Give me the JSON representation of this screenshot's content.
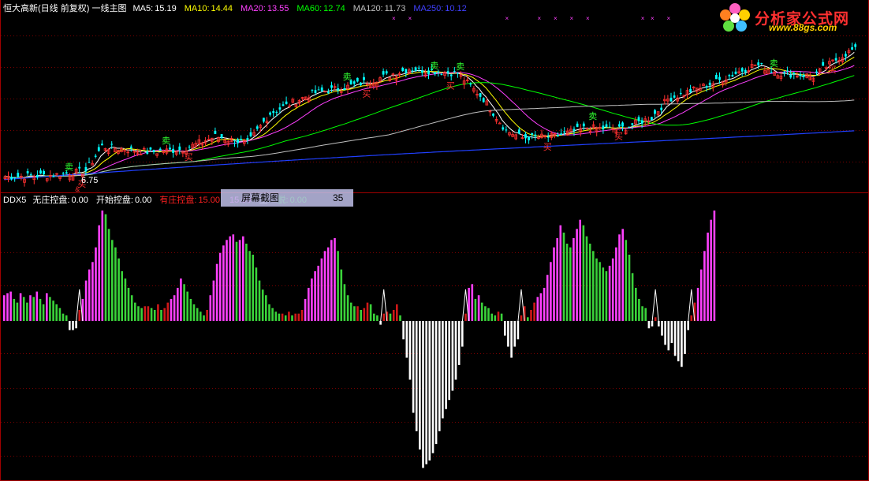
{
  "main_header": {
    "stock": "恒大高新(日线 前复权) 一线主图",
    "items": [
      {
        "label": "MA5:",
        "value": "15.19",
        "color": "#ffffff"
      },
      {
        "label": "MA10:",
        "value": "14.44",
        "color": "#ffff00"
      },
      {
        "label": "MA20:",
        "value": "13.55",
        "color": "#ff40ff"
      },
      {
        "label": "MA60:",
        "value": "12.74",
        "color": "#00ff00"
      },
      {
        "label": "MA120:",
        "value": "11.73",
        "color": "#c0c0c0"
      },
      {
        "label": "MA250:",
        "value": "10.12",
        "color": "#4040ff"
      }
    ]
  },
  "indicator_header": {
    "name": "DDX5",
    "items": [
      {
        "label": "无庄控盘:",
        "value": "0.00",
        "color": "#ffffff"
      },
      {
        "label": "开始控盘:",
        "value": "0.00",
        "color": "#ffffff"
      },
      {
        "label": "有庄控盘:",
        "value": "15.00",
        "color": "#ff2020"
      },
      {
        "label": "",
        "value": "15.00",
        "color": "#ff40ff"
      },
      {
        "label": "主",
        "value": "",
        "color": "#ffffff"
      },
      {
        "label": "脱:",
        "value": "0.00",
        "color": "#00ff00"
      }
    ]
  },
  "watermark": {
    "title": "分析家公式网",
    "url": "www.88gs.com"
  },
  "capture_tooltip": {
    "label": "屏幕截图",
    "value": "35"
  },
  "price_chart": {
    "type": "candlestick",
    "min_price_label": "6.75",
    "buy_label": "买",
    "sell_label": "卖",
    "ylim": [
      6.2,
      18.0
    ],
    "colors": {
      "up": "#ff3030",
      "down": "#00ffff",
      "ma5": "#ffffff",
      "ma10": "#ffff00",
      "ma20": "#ff40ff",
      "ma60": "#00ff00",
      "ma120": "#c0c0c0",
      "ma250": "#2040ff"
    },
    "anchors": [
      [
        0,
        6.8
      ],
      [
        15,
        6.9
      ],
      [
        25,
        7.2
      ],
      [
        30,
        8.9
      ],
      [
        45,
        8.5
      ],
      [
        55,
        8.7
      ],
      [
        65,
        9.6
      ],
      [
        75,
        9.1
      ],
      [
        82,
        11.2
      ],
      [
        95,
        12.6
      ],
      [
        105,
        13.0
      ],
      [
        115,
        13.6
      ],
      [
        125,
        14.3
      ],
      [
        135,
        14.1
      ],
      [
        140,
        14.0
      ],
      [
        148,
        12.2
      ],
      [
        155,
        10.0
      ],
      [
        160,
        9.5
      ],
      [
        170,
        9.6
      ],
      [
        180,
        10.2
      ],
      [
        190,
        10.1
      ],
      [
        200,
        10.9
      ],
      [
        205,
        12.2
      ],
      [
        215,
        13.0
      ],
      [
        220,
        13.4
      ],
      [
        232,
        14.6
      ],
      [
        240,
        14.0
      ],
      [
        250,
        13.8
      ],
      [
        258,
        15.1
      ],
      [
        262,
        15.6
      ]
    ],
    "signals": [
      {
        "i": 20,
        "type": "sell"
      },
      {
        "i": 24,
        "type": "buy"
      },
      {
        "i": 50,
        "type": "sell"
      },
      {
        "i": 57,
        "type": "buy"
      },
      {
        "i": 106,
        "type": "sell"
      },
      {
        "i": 112,
        "type": "buy"
      },
      {
        "i": 133,
        "type": "sell"
      },
      {
        "i": 138,
        "type": "buy"
      },
      {
        "i": 141,
        "type": "sell"
      },
      {
        "i": 168,
        "type": "buy"
      },
      {
        "i": 182,
        "type": "sell"
      },
      {
        "i": 190,
        "type": "buy"
      },
      {
        "i": 238,
        "type": "sell"
      },
      {
        "i": 256,
        "type": "buy"
      }
    ],
    "cross_marks": [
      120,
      125,
      155,
      165,
      170,
      175,
      180,
      197,
      200,
      205
    ]
  },
  "chart_data": {
    "type": "bar",
    "name": "DDX5",
    "positive_colors": {
      "rising": "#ff40ff",
      "falling": "#3ad33a",
      "early": "#d01818"
    },
    "negative_color": "#ffffff",
    "ylim": [
      -85,
      60
    ],
    "values": [
      14,
      15,
      16,
      12,
      10,
      15,
      13,
      10,
      14,
      13,
      16,
      12,
      9,
      15,
      13,
      11,
      9,
      7,
      4,
      3,
      -5,
      -5,
      -4,
      6,
      12,
      22,
      28,
      32,
      40,
      52,
      60,
      58,
      50,
      44,
      40,
      34,
      27,
      23,
      18,
      14,
      10,
      8,
      7,
      8,
      8,
      7,
      6,
      9,
      6,
      7,
      10,
      12,
      14,
      18,
      23,
      20,
      16,
      12,
      9,
      7,
      5,
      3,
      6,
      14,
      22,
      31,
      37,
      41,
      44,
      46,
      47,
      43,
      44,
      46,
      42,
      38,
      36,
      29,
      22,
      17,
      14,
      9,
      7,
      5,
      4,
      4,
      3,
      5,
      3,
      4,
      4,
      6,
      12,
      18,
      23,
      27,
      30,
      34,
      38,
      40,
      44,
      45,
      38,
      28,
      20,
      14,
      10,
      8,
      8,
      6,
      7,
      10,
      9,
      4,
      3,
      -2,
      4,
      5,
      4,
      6,
      9,
      3,
      -10,
      -20,
      -32,
      -50,
      -60,
      -70,
      -80,
      -78,
      -76,
      -72,
      -67,
      -60,
      -53,
      -48,
      -43,
      -38,
      -32,
      -24,
      -14,
      4,
      18,
      20,
      12,
      14,
      10,
      8,
      7,
      4,
      3,
      5,
      4,
      -8,
      -14,
      -20,
      -14,
      -10,
      3,
      8,
      2,
      6,
      10,
      13,
      15,
      18,
      25,
      32,
      40,
      45,
      52,
      48,
      42,
      40,
      45,
      50,
      55,
      52,
      46,
      42,
      38,
      34,
      32,
      29,
      27,
      30,
      34,
      40,
      47,
      50,
      44,
      36,
      26,
      18,
      12,
      8,
      7,
      -4,
      -3,
      2,
      -3,
      -8,
      -13,
      -16,
      -12,
      -19,
      -22,
      -25,
      -18,
      -5,
      3,
      10,
      18,
      28,
      38,
      48,
      55,
      60
    ]
  }
}
